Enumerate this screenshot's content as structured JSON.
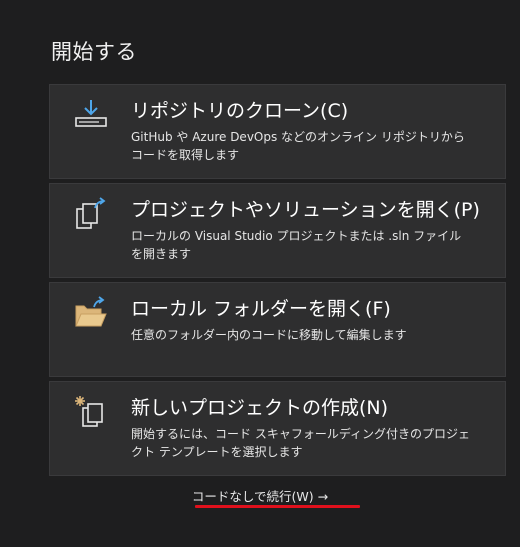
{
  "page": {
    "title": "開始する"
  },
  "cards": [
    {
      "title": "リポジトリのクローン(C)",
      "description": "GitHub や Azure DevOps などのオンライン リポジトリからコードを取得します",
      "icon": "download-icon"
    },
    {
      "title": "プロジェクトやソリューションを開く(P)",
      "description": "ローカルの Visual Studio プロジェクトまたは .sln ファイルを開きます",
      "icon": "open-project-icon"
    },
    {
      "title": "ローカル フォルダーを開く(F)",
      "description": "任意のフォルダー内のコードに移動して編集します",
      "icon": "open-folder-icon"
    },
    {
      "title": "新しいプロジェクトの作成(N)",
      "description": "開始するには、コード スキャフォールディング付きのプロジェクト テンプレートを選択します",
      "icon": "new-project-icon"
    }
  ],
  "continue": {
    "label": "コードなしで続行(W) →"
  },
  "colors": {
    "background": "#1e1e1f",
    "card": "#2e2e2f",
    "icon_blue": "#4ea6ea",
    "folder_yellow": "#dcb67a",
    "underline_red": "#e0101c"
  }
}
